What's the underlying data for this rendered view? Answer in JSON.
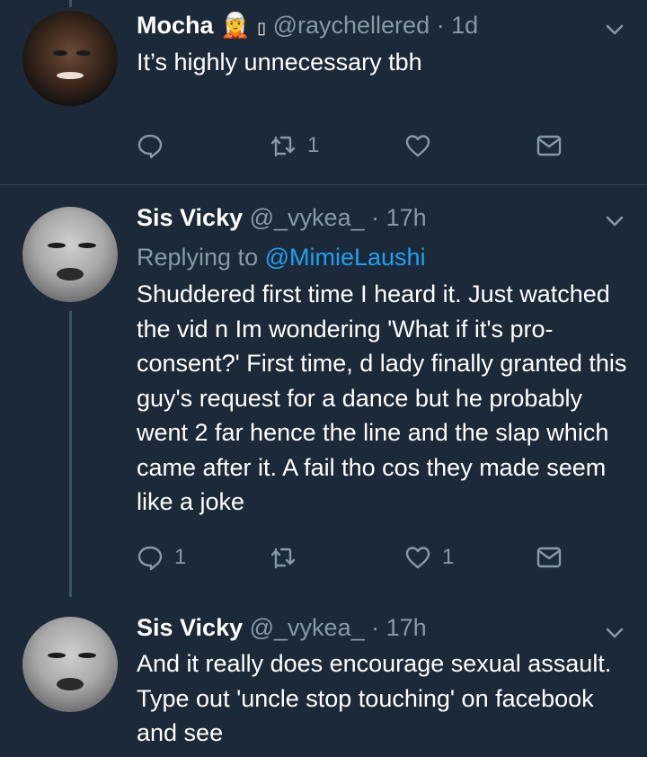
{
  "tweets": [
    {
      "name": "Mocha",
      "emoji": "🧝",
      "badge": "▯",
      "handle": "@raychellered",
      "dot": "·",
      "time": "1d",
      "text": "It’s highly unnecessary tbh",
      "reply_count": "",
      "retweet_count": "1",
      "like_count": ""
    },
    {
      "name": "Sis Vicky",
      "handle": "@_vykea_",
      "dot": "·",
      "time": "17h",
      "replying_prefix": "Replying to",
      "replying_to": "@MimieLaushi",
      "text": "Shuddered first time I heard it. Just watched the vid n Im wondering 'What if it's pro-consent?' First time, d lady finally granted this guy's request for a dance but he probably went 2 far hence the line and the slap which came after it. A fail tho cos they made seem like a joke",
      "reply_count": "1",
      "retweet_count": "",
      "like_count": "1"
    },
    {
      "name": "Sis Vicky",
      "handle": "@_vykea_",
      "dot": "·",
      "time": "17h",
      "text": "And it really does encourage sexual assault. Type out 'uncle stop touching' on facebook and see"
    }
  ],
  "icons": {
    "reply": "reply-icon",
    "retweet": "retweet-icon",
    "like": "heart-icon",
    "dm": "envelope-icon",
    "menu": "chevron-down-icon"
  },
  "colors": {
    "background": "#1c2938",
    "secondary_text": "#8899a6",
    "link": "#1da1f2"
  }
}
